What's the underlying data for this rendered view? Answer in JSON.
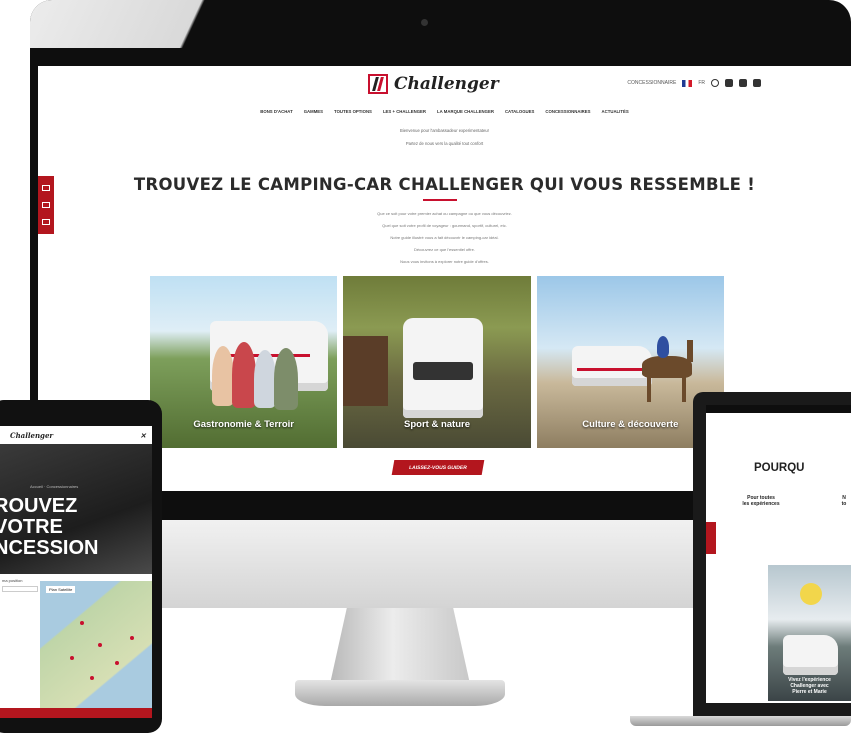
{
  "desktop": {
    "brand": "Challenger",
    "header_right": {
      "label": "CONCESSIONNAIRE",
      "lang": "FR"
    },
    "nav": [
      "BONS D'ACHAT",
      "GAMMES",
      "TOUTES OPTIONS",
      "LES + CHALLENGER",
      "LA MARQUE CHALLENGER",
      "CATALOGUES",
      "CONCESSIONNAIRES",
      "ACTUALITÉS"
    ],
    "intro": [
      "Bienvenue pour l'ambassadeur experimentateur",
      "Partez de nous vers la qualité tout confort"
    ],
    "headline": "TROUVEZ LE CAMPING-CAR CHALLENGER QUI VOUS RESSEMBLE !",
    "body_lines": [
      "Que ce soit pour votre premier achat ou campagne ou que vous découvriez.",
      "Quel que soit votre profil de voyageur : gourmand, sportif, culturel, etc.",
      "Notre guide illustré vous a fait découvrir le camping-car idéal.",
      "Découvrez ce que l'essentiel offre.",
      "Nous vous invitons à explorer notre guide d'offres."
    ],
    "cards": [
      {
        "label": "Gastronomie & Terroir"
      },
      {
        "label": "Sport & nature"
      },
      {
        "label": "Culture & découverte"
      }
    ],
    "cta": "LAISSEZ-VOUS GUIDER",
    "accent": "#b3161e"
  },
  "tablet": {
    "brand": "Challenger",
    "crumb": "Accueil · Concessionnaires",
    "hero_lines": [
      "ROUVEZ",
      "VOTRE",
      "NCESSION"
    ],
    "search_label": "ma position",
    "map_tabs": "Plan  Satellite"
  },
  "laptop": {
    "title": "POURQU",
    "col1_title": "Pour toutes\nles expériences",
    "col2_title": "N\nto",
    "image_caption": "Vivez l'expérience\nChallenger avec\nPierre et Marie"
  }
}
